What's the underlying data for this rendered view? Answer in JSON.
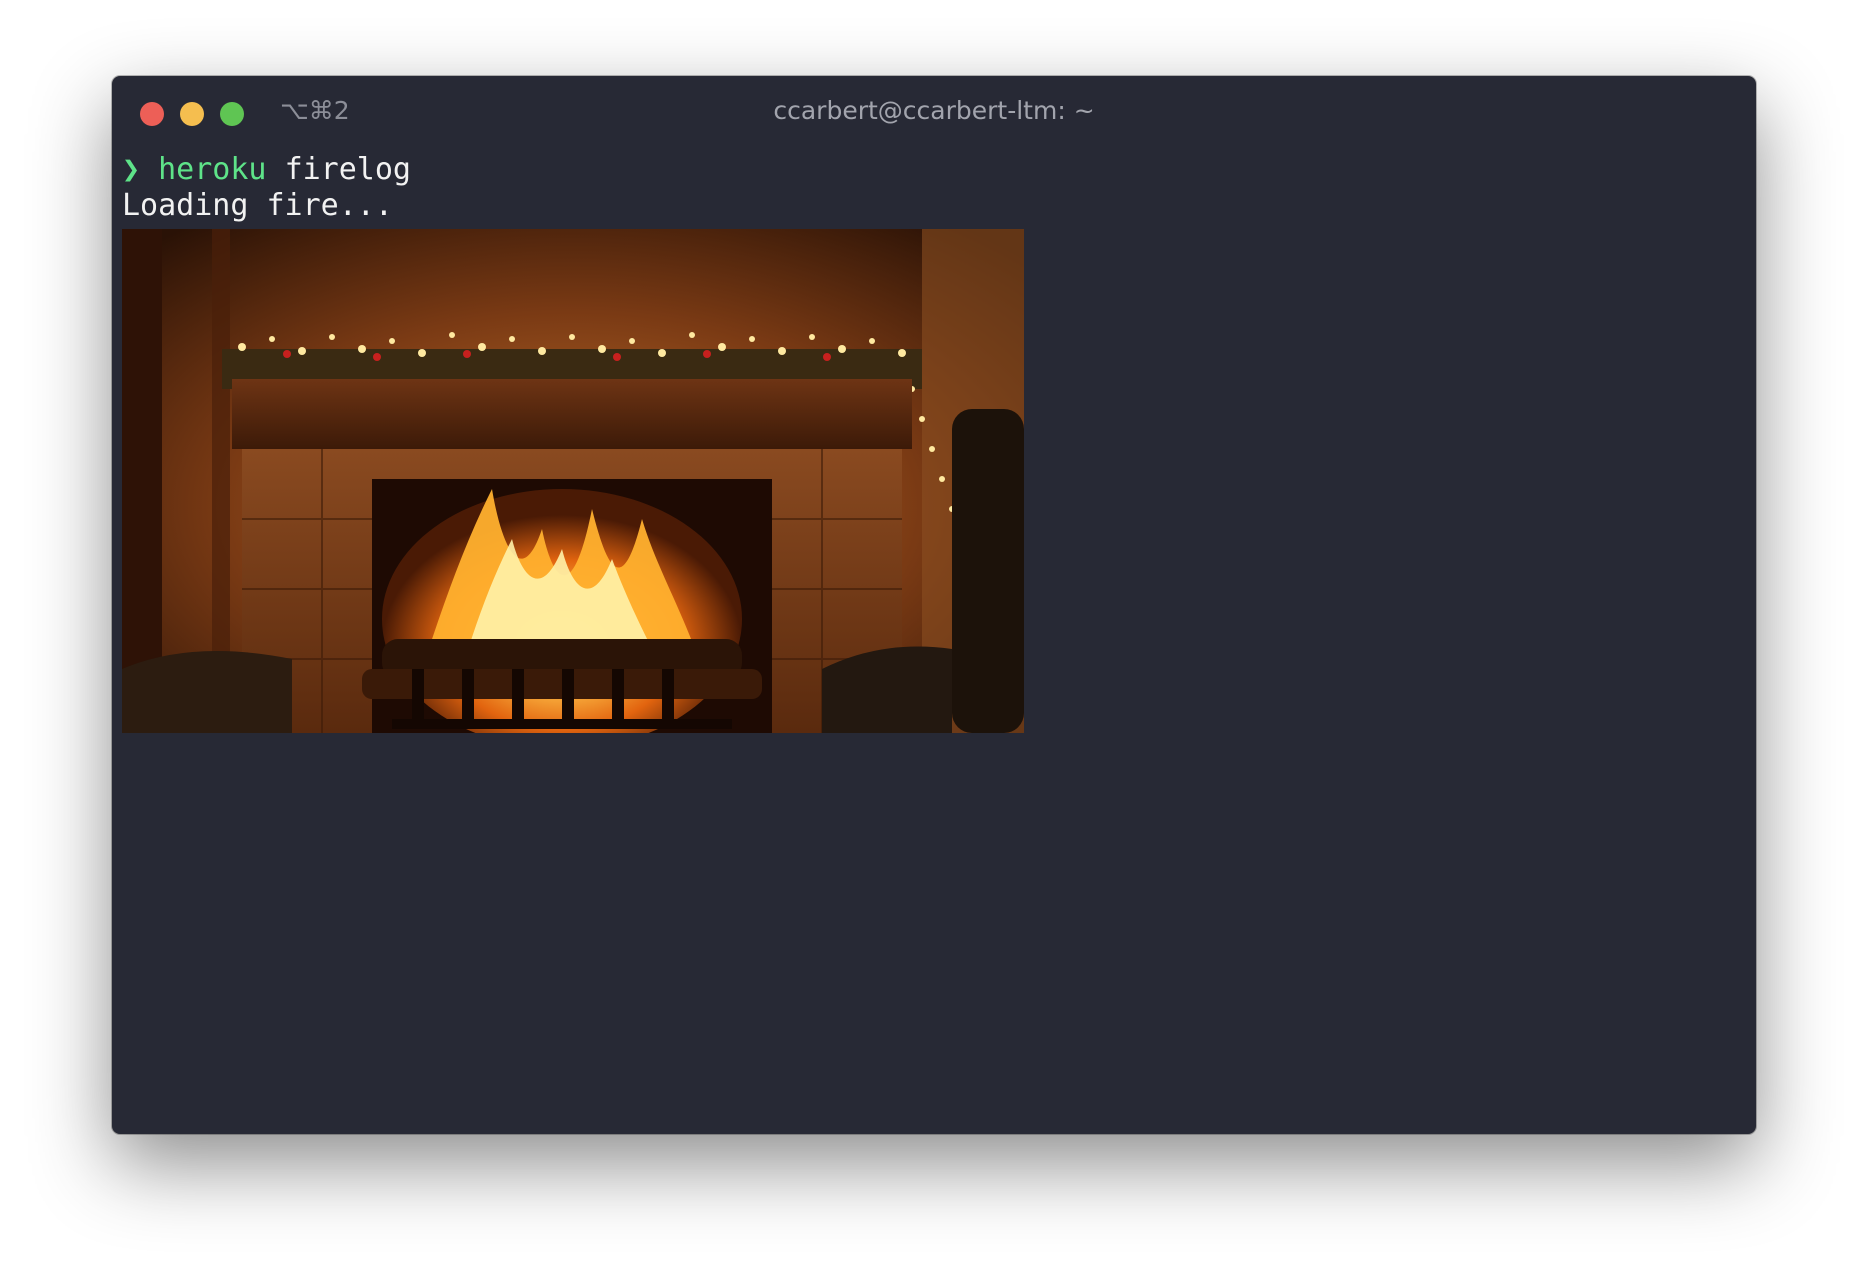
{
  "window": {
    "title": "ccarbert@ccarbert-ltm: ~",
    "shortcut": "⌥⌘2"
  },
  "terminal": {
    "prompt_symbol": "❯",
    "command": "heroku",
    "argument": "firelog",
    "output": "Loading fire..."
  },
  "image": {
    "subject": "fireplace-image"
  },
  "colors": {
    "background": "#272935",
    "prompt": "#5ee389",
    "text": "#f2f2f2",
    "close": "#ed5f57",
    "minimize": "#f5be4f",
    "zoom": "#5fc553"
  }
}
